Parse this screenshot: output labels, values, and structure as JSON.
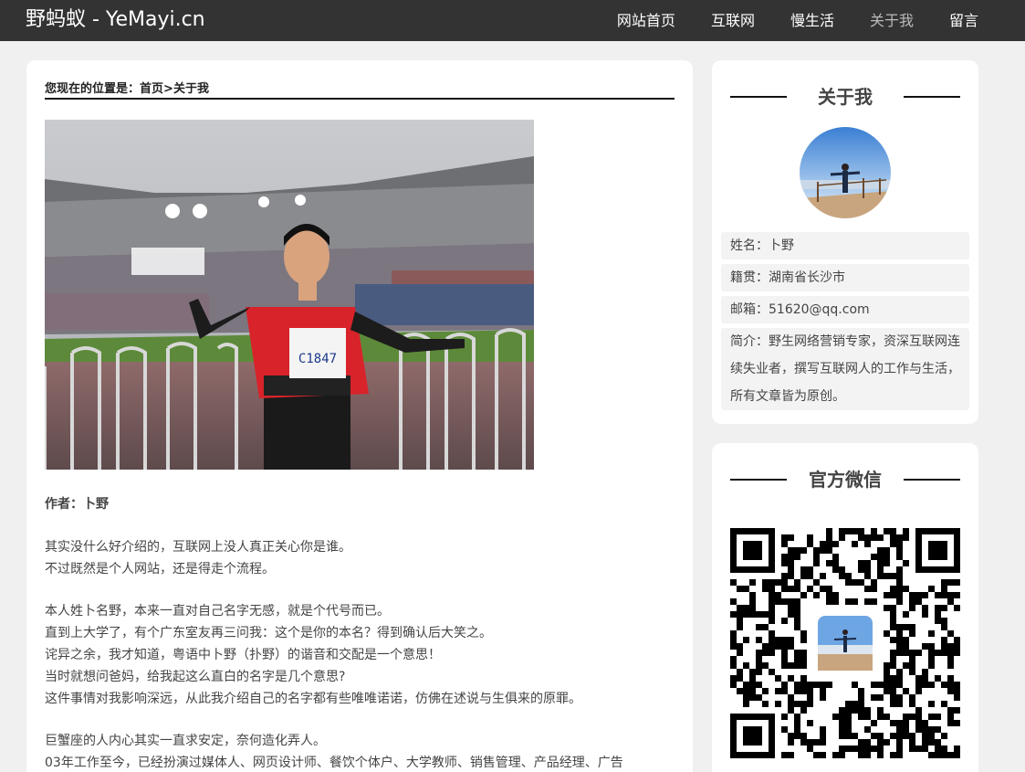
{
  "header": {
    "logo": "野蚂蚁 - YeMayi.cn",
    "nav": [
      {
        "label": "网站首页"
      },
      {
        "label": "互联网"
      },
      {
        "label": "慢生活"
      },
      {
        "label": "关于我"
      },
      {
        "label": "留言"
      }
    ]
  },
  "breadcrumb": {
    "prefix": "您现在的位置是：",
    "home": "首页",
    "separator": ">",
    "current": "关于我"
  },
  "article": {
    "author": "作者：卜野",
    "paragraphs": [
      [
        "其实没什么好介绍的，互联网上没人真正关心你是谁。",
        "不过既然是个人网站，还是得走个流程。"
      ],
      [
        "本人姓卜名野，本来一直对自己名字无感，就是个代号而已。",
        "直到上大学了，有个广东室友再三问我：这个是你的本名？得到确认后大笑之。",
        "诧异之余，我才知道，粤语中卜野（扑野）的谐音和交配是一个意思！",
        "当时就想问爸妈，给我起这么直白的名字是几个意思?",
        "这件事情对我影响深远，从此我介绍自己的名字都有些唯唯诺诺，仿佛在述说与生俱来的原罪。"
      ],
      [
        "巨蟹座的人内心其实一直求安定，奈何造化弄人。",
        "03年工作至今，已经扮演过媒体人、网页设计师、餐饮个体户、大学教师、销售管理、产品经理、广告"
      ]
    ]
  },
  "sidebar": {
    "about": {
      "title": "关于我",
      "name": "姓名：卜野",
      "hometown": "籍贯：湖南省长沙市",
      "email": "邮箱：51620@qq.com",
      "bio": "简介：野生网络营销专家，资深互联网连续失业者，撰写互联网人的工作与生活，所有文章皆为原创。"
    },
    "wechat": {
      "title": "官方微信"
    }
  },
  "colors": {
    "header_bg": "#333333",
    "page_bg": "#f0f0f0",
    "card_bg": "#ffffff",
    "info_bg": "#f3f3f3"
  }
}
